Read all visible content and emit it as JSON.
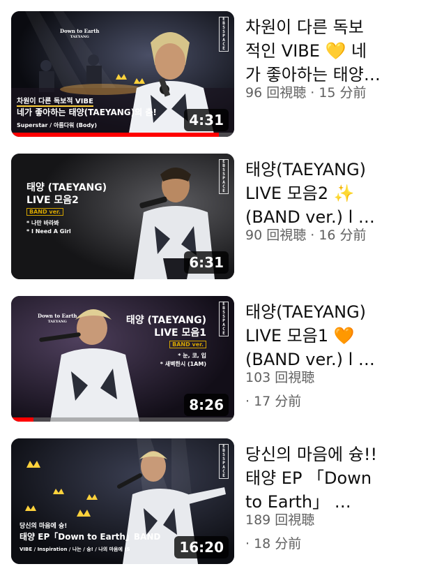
{
  "brand": {
    "label": "EBS SPACE",
    "chars": [
      "E",
      "B",
      "S",
      "S",
      "P",
      "A",
      "C",
      "E"
    ]
  },
  "colors": {
    "progress": "#ff0000",
    "text_primary": "#0f0f0f",
    "text_secondary": "#606060",
    "accent_yellow": "#ffd23c",
    "accent_gold": "#d7a600"
  },
  "videos": [
    {
      "title_lines": [
        "차원이 다른 독보",
        "적인 VIBE 💛 네",
        "가 좋아하는 태양…"
      ],
      "views": "96 回視聴",
      "sep": " · ",
      "age": "15 分前",
      "duration": "4:31",
      "watched_fraction": 0.93,
      "thumb_text": {
        "logo_line1": "Down to Earth",
        "logo_line2": "TAEYANG",
        "line1": "차원이 다른 독보적 VIBE",
        "line2": "네가 좋아하는 태양(TAEYANG)의 춤!",
        "footer": "Superstar / 아름다워 (Body)"
      }
    },
    {
      "title_lines": [
        "태양(TAEYANG)",
        "LIVE 모음2 ✨",
        "(BAND ver.) l …"
      ],
      "views": "90 回視聴",
      "sep": " · ",
      "age": "16 分前",
      "duration": "6:31",
      "watched_fraction": 0,
      "thumb_text": {
        "line1": "태양 (TAEYANG)",
        "line2": "LIVE 모음2",
        "badge": "BAND ver.",
        "item1": "* 나만 바라봐",
        "item2": "* I Need A Girl"
      }
    },
    {
      "title_lines": [
        "태양(TAEYANG)",
        "LIVE 모음1 🧡",
        "(BAND ver.) l …"
      ],
      "views": "103 回視聴",
      "sep": "· ",
      "age": "17 分前",
      "duration": "8:26",
      "watched_fraction": 0.1,
      "thumb_text": {
        "logo_line1": "Down to Earth",
        "logo_line2": "TAEYANG",
        "line1": "태양 (TAEYANG)",
        "line2": "LIVE 모음1",
        "badge": "BAND ver.",
        "item1": "* 눈, 코, 입",
        "item2": "* 새벽한시 (1AM)"
      }
    },
    {
      "title_lines": [
        "당신의 마음에 슝!!",
        "태양 EP 「Down",
        "to Earth」 …"
      ],
      "views": "189 回視聴",
      "sep": "· ",
      "age": "18 分前",
      "duration": "16:20",
      "watched_fraction": 0,
      "thumb_text": {
        "line1": "당신의 마음에 슝!",
        "line2": "태양 EP「Down to Earth」BAND",
        "footer": "VIBE / Inspiration / 나는 / 슝! / 나의 마음에 (S"
      }
    }
  ]
}
